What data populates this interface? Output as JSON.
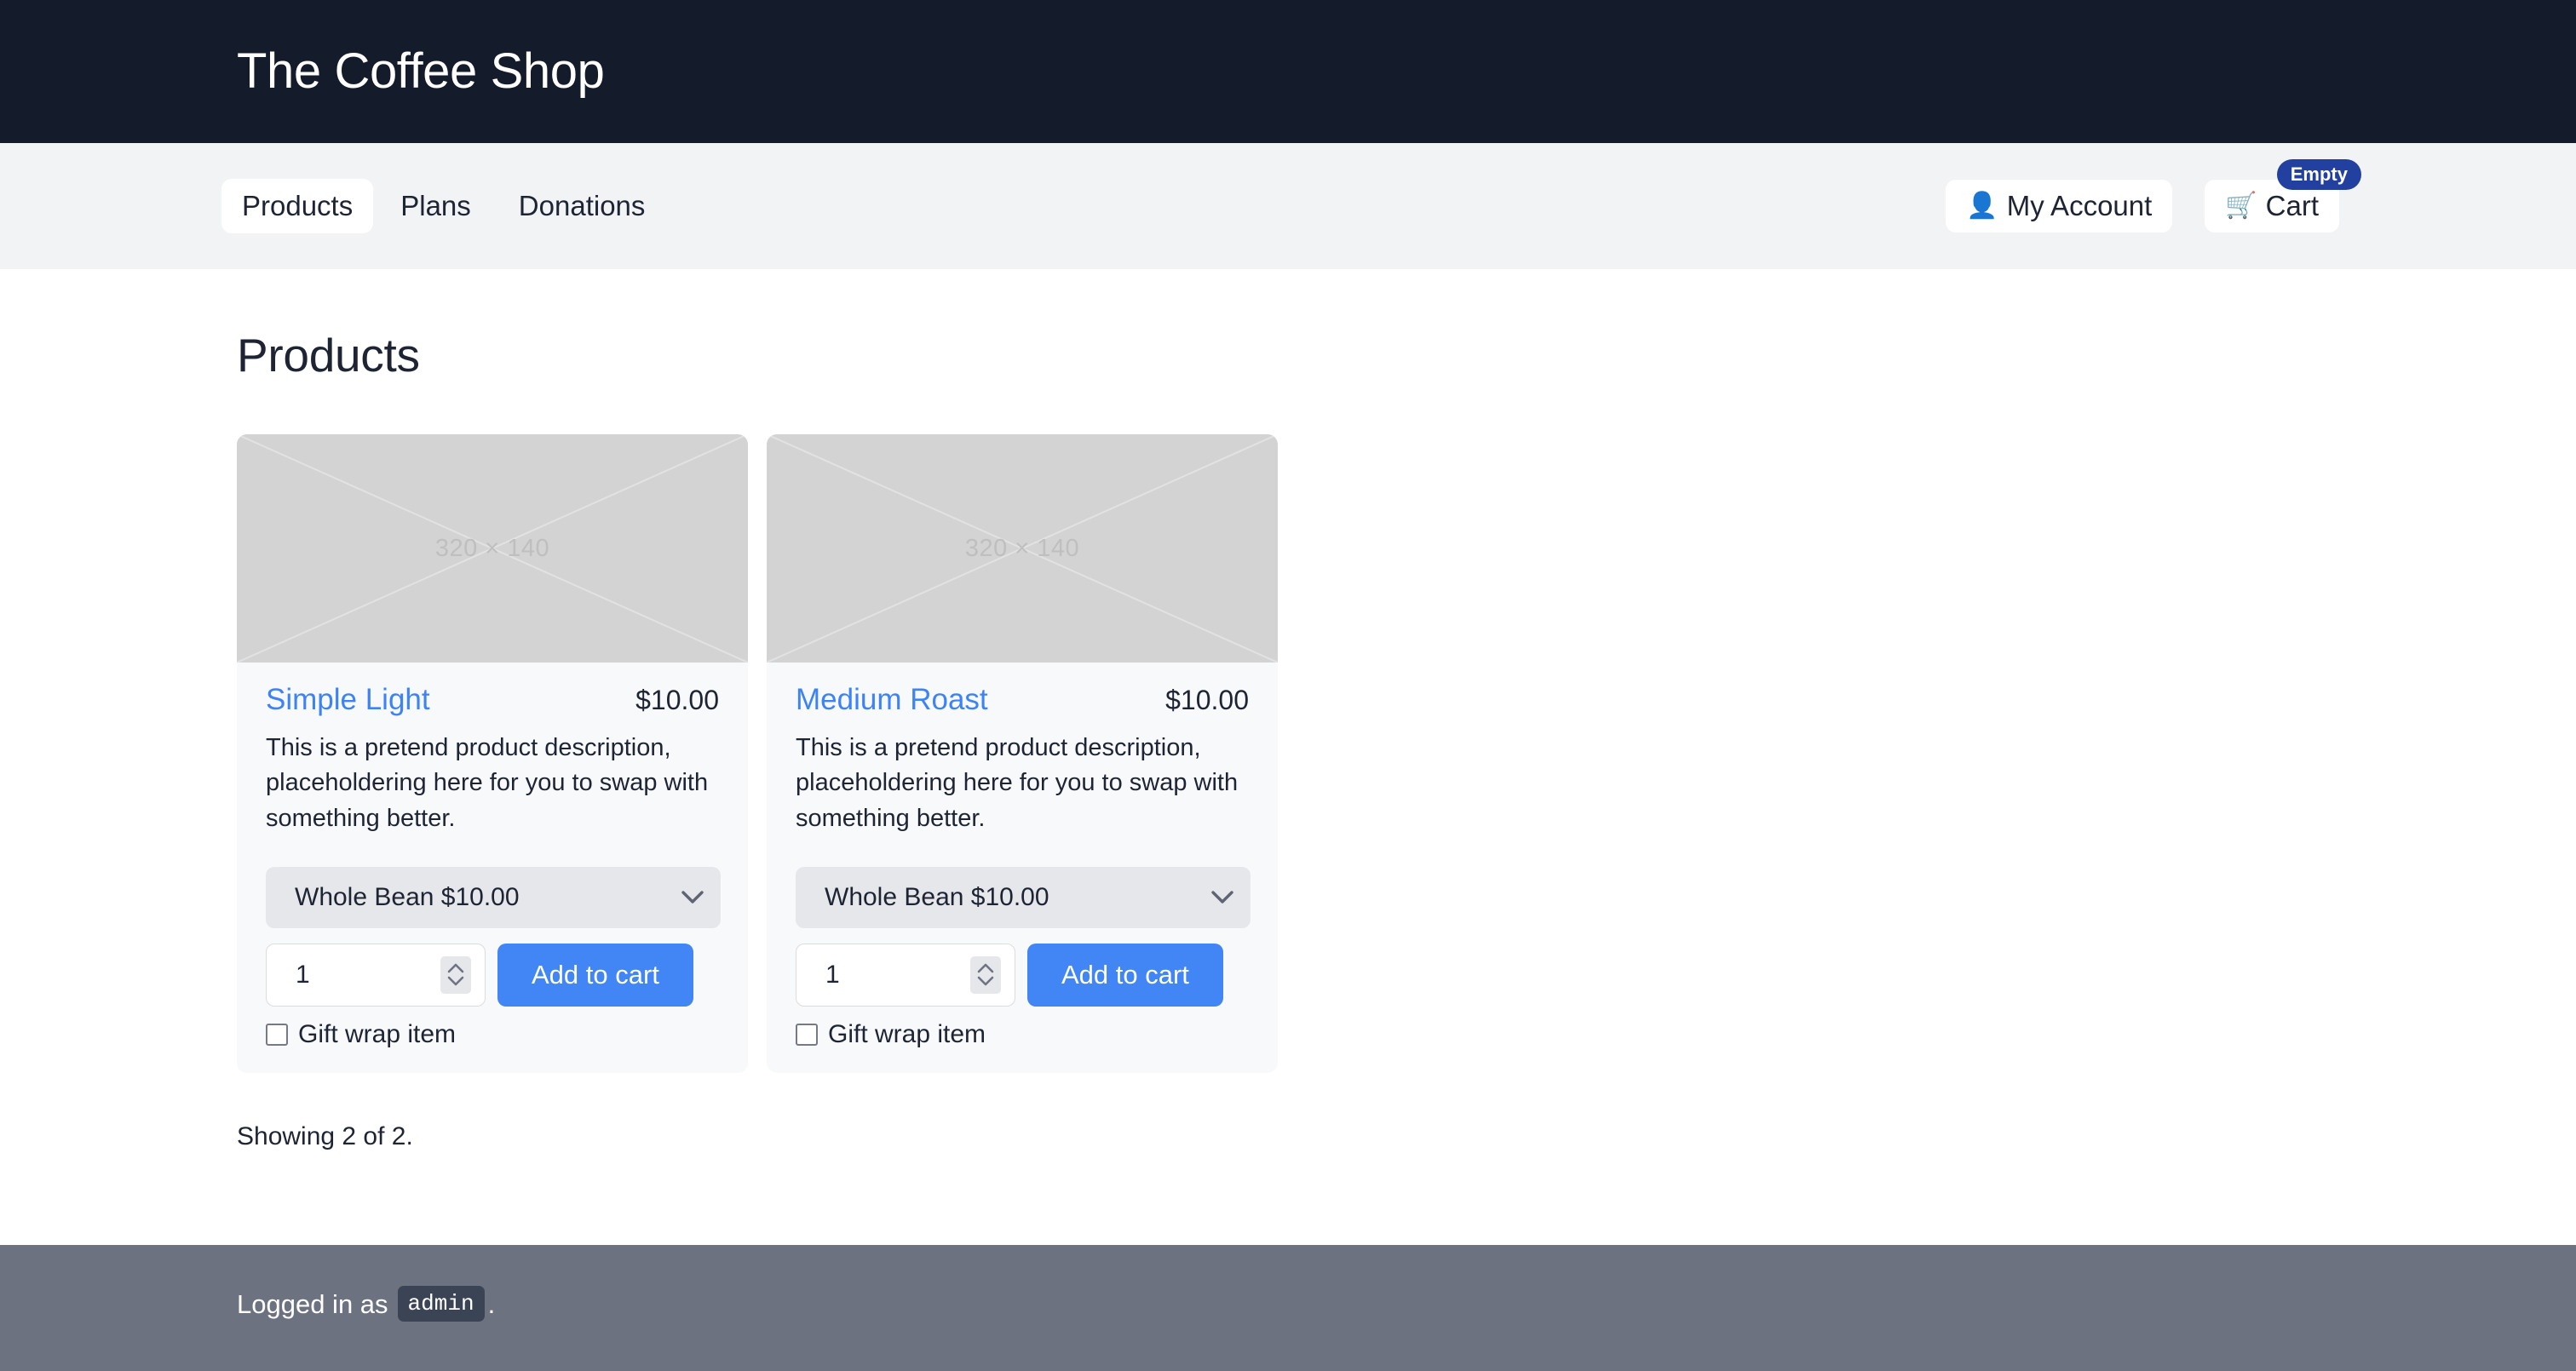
{
  "site": {
    "title": "The Coffee Shop",
    "header_bg": "#141b2a",
    "navbar_bg": "#f1f3f5",
    "accent_blue": "#4285f4",
    "link_blue": "#3d83f7",
    "badge_blue": "#22409f",
    "footer_bg": "#6c7280"
  },
  "nav": {
    "links": [
      {
        "label": "Products",
        "active": true
      },
      {
        "label": "Plans",
        "active": false
      },
      {
        "label": "Donations",
        "active": false
      }
    ],
    "account": {
      "label": "My Account",
      "icon": "bust-in-silhouette",
      "glyph": "👤"
    },
    "cart": {
      "label": "Cart",
      "icon": "shopping-cart",
      "glyph": "🛒",
      "badge": "Empty"
    }
  },
  "main": {
    "page_title": "Products",
    "showing": "Showing 2 of 2.",
    "products": [
      {
        "name": "Simple Light",
        "price": "$10.00",
        "description": "This is a pretend product description, placeholdering here for you to swap with something better.",
        "image_placeholder": "320 × 140",
        "variant_selected": "Whole Bean $10.00",
        "quantity": "1",
        "add_label": "Add to cart",
        "gift_label": "Gift wrap item",
        "gift_checked": false
      },
      {
        "name": "Medium Roast",
        "price": "$10.00",
        "description": "This is a pretend product description, placeholdering here for you to swap with something better.",
        "image_placeholder": "320 × 140",
        "variant_selected": "Whole Bean $10.00",
        "quantity": "1",
        "add_label": "Add to cart",
        "gift_label": "Gift wrap item",
        "gift_checked": false
      }
    ]
  },
  "footer": {
    "prefix": "Logged in as",
    "user": "admin",
    "suffix": "."
  }
}
